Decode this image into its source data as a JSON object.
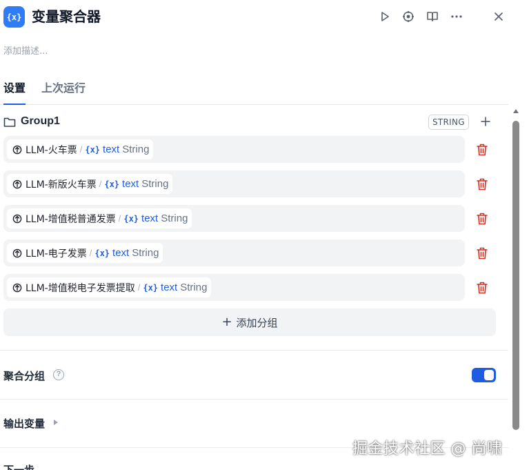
{
  "header": {
    "app_icon": "{x}",
    "title": "变量聚合器",
    "description_placeholder": "添加描述...",
    "actions": [
      "play-icon",
      "crosshair-icon",
      "book-icon",
      "more-icon",
      "close-icon"
    ]
  },
  "tabs": [
    {
      "label": "设置",
      "active": true
    },
    {
      "label": "上次运行",
      "active": false
    }
  ],
  "group": {
    "name": "Group1",
    "type": "STRING",
    "variables": [
      {
        "node": "LLM-火车票",
        "var_icon": "{x}",
        "var": "text",
        "type": "String"
      },
      {
        "node": "LLM-新版火车票",
        "var_icon": "{x}",
        "var": "text",
        "type": "String"
      },
      {
        "node": "LLM-增值税普通发票",
        "var_icon": "{x}",
        "var": "text",
        "type": "String"
      },
      {
        "node": "LLM-电子发票",
        "var_icon": "{x}",
        "var": "text",
        "type": "String"
      },
      {
        "node": "LLM-增值税电子发票提取",
        "var_icon": "{x}",
        "var": "text",
        "type": "String"
      }
    ]
  },
  "add_group_label": "添加分组",
  "aggregate_group": {
    "label": "聚合分组",
    "help": "?",
    "enabled": true
  },
  "output_vars_label": "输出变量",
  "next_step_label": "下一步",
  "watermark": "掘金技术社区 @ 尚啸",
  "colors": {
    "accent": "#1f5de0",
    "danger": "#d92d20",
    "app_icon": "#2f7df6"
  }
}
